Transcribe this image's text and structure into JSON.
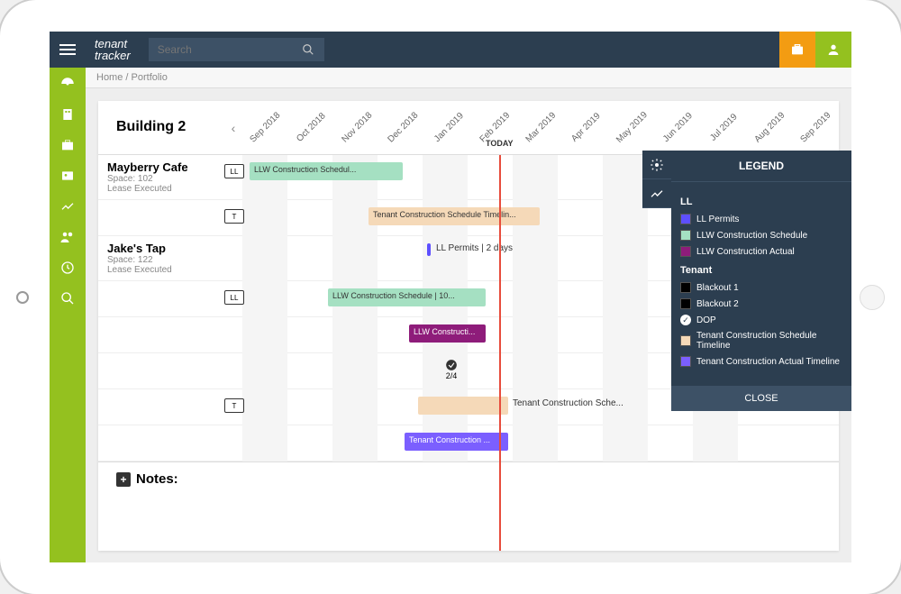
{
  "search": {
    "placeholder": "Search"
  },
  "breadcrumb": {
    "home": "Home",
    "sep": " / ",
    "current": "Portfolio"
  },
  "gantt": {
    "title": "Building 2",
    "months": [
      "Sep 2018",
      "Oct 2018",
      "Nov 2018",
      "Dec 2018",
      "Jan 2019",
      "Feb 2019",
      "Mar 2019",
      "Apr 2019",
      "May 2019",
      "Jun 2019",
      "Jul 2019",
      "Aug 2019",
      "Sep 2019"
    ],
    "today_label": "TODAY",
    "rows": [
      {
        "name": "Mayberry Cafe",
        "space": "Space: 102",
        "status": "Lease Executed"
      },
      {
        "name": "Jake's Tap",
        "space": "Space: 122",
        "status": "Lease Executed"
      }
    ],
    "bars": {
      "llw_sched_1": "LLW Construction Schedul...",
      "tenant_sched_1": "Tenant Construction Schedule Timelin...",
      "ll_permits": "LL Permits | 2 days",
      "llw_sched_2": "LLW Construction Schedule | 10...",
      "llw_actual": "LLW Constructi...",
      "checkmark_label": "2/4",
      "tenant_sched_2": "Tenant Construction Sche...",
      "tenant_actual": "Tenant Construction ..."
    },
    "icons": {
      "ll": "LL",
      "t": "T"
    },
    "notes_label": "Notes:"
  },
  "legend": {
    "title": "LEGEND",
    "ll_title": "LL",
    "ll_items": [
      {
        "label": "LL Permits",
        "color": "#5d4fff"
      },
      {
        "label": "LLW Construction Schedule",
        "color": "#a5e0c2"
      },
      {
        "label": "LLW Construction Actual",
        "color": "#8e1c7a"
      }
    ],
    "tenant_title": "Tenant",
    "tenant_items": [
      {
        "label": "Blackout 1",
        "color": "#000"
      },
      {
        "label": "Blackout 2",
        "color": "#000"
      }
    ],
    "dop_label": "DOP",
    "tenant_items2": [
      {
        "label": "Tenant Construction Schedule Timeline",
        "color": "#f5d9b8"
      },
      {
        "label": "Tenant Construction Actual Timeline",
        "color": "#7b5fff"
      }
    ],
    "close": "CLOSE"
  },
  "colors": {
    "llw_schedule": "#a5e0c2",
    "tenant_schedule": "#f5d9b8",
    "ll_permits": "#5d4fff",
    "llw_actual": "#8e1c7a",
    "tenant_actual": "#7b5fff"
  }
}
